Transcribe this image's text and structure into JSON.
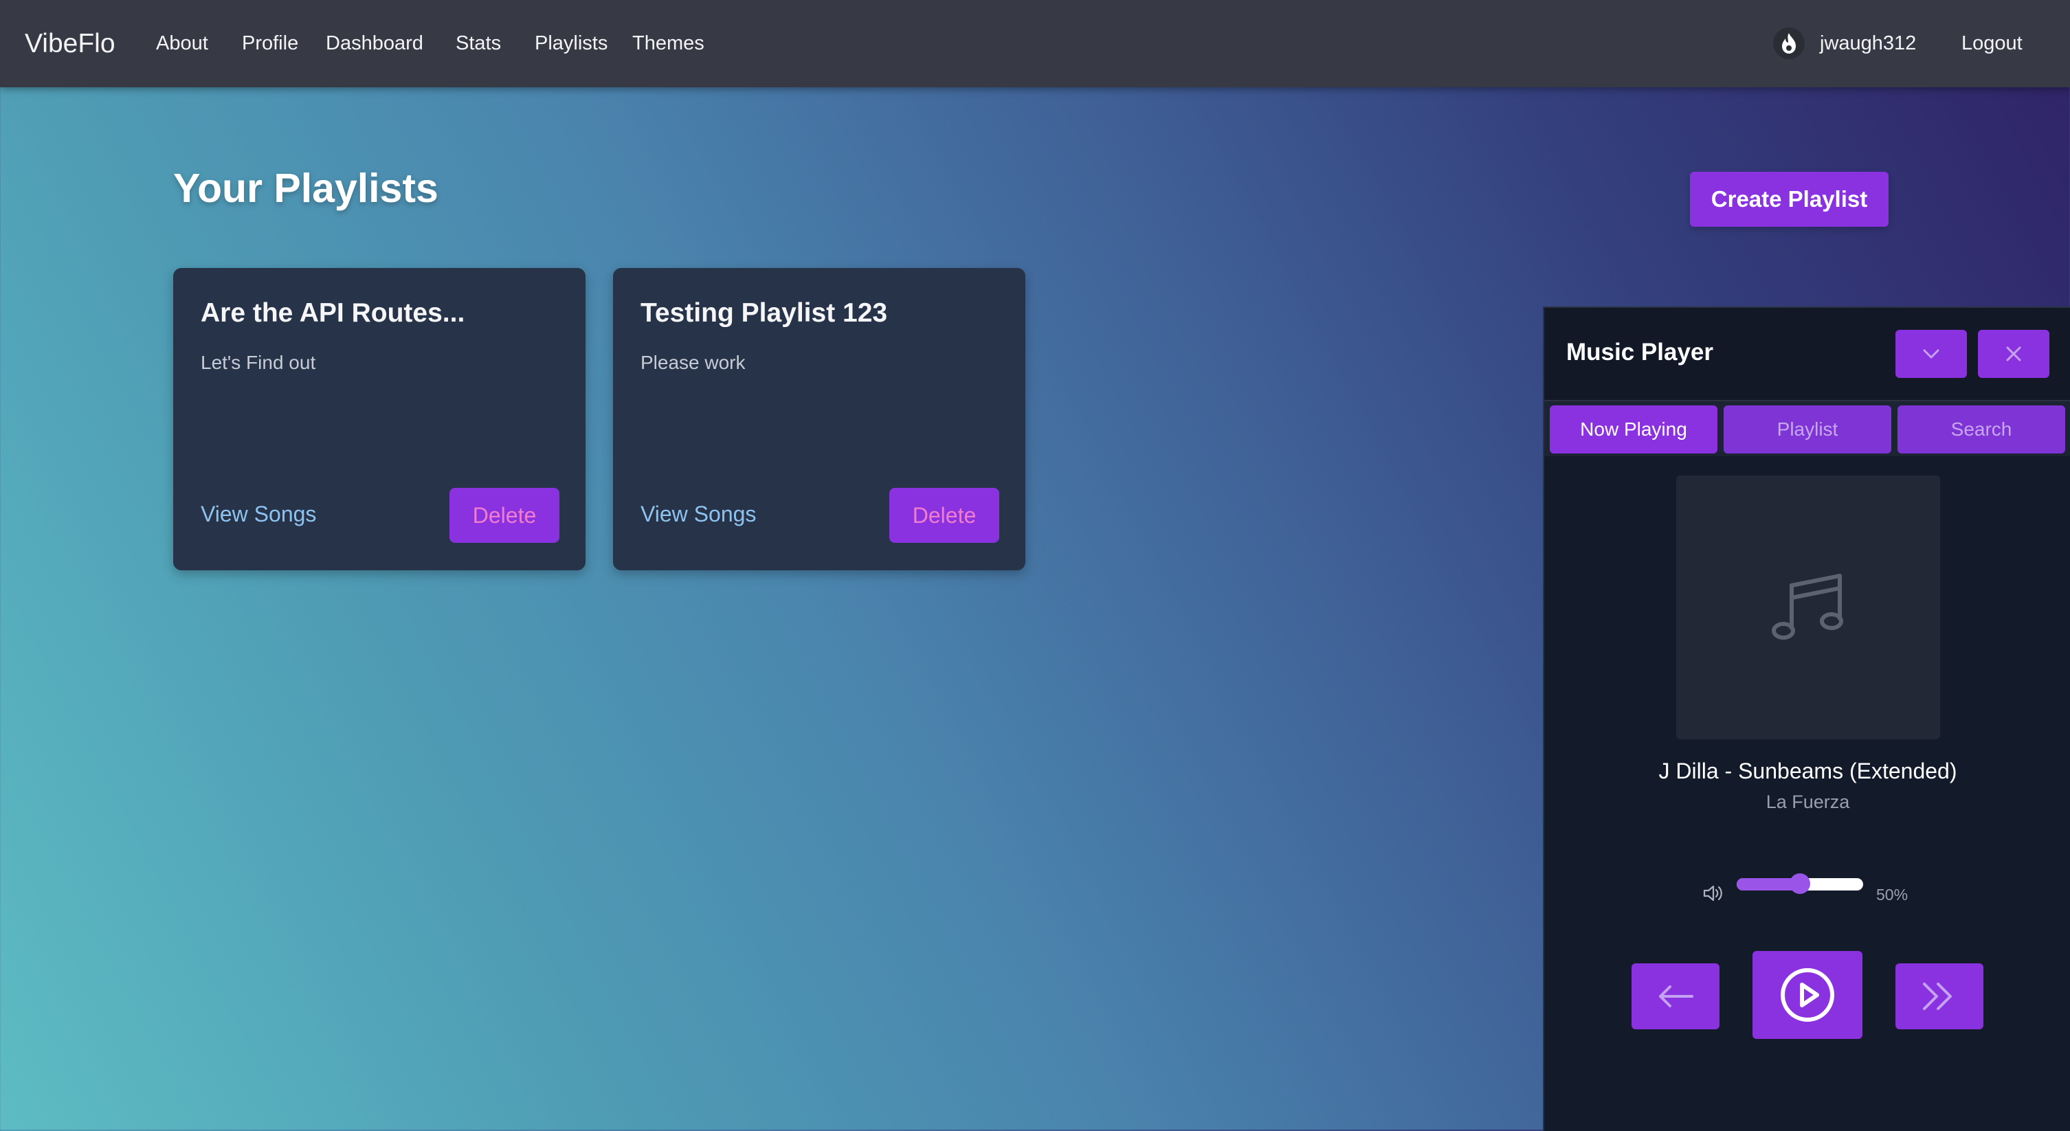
{
  "nav": {
    "brand": "VibeFlo",
    "links": [
      "About",
      "Profile",
      "Dashboard",
      "Stats",
      "Playlists",
      "Themes"
    ],
    "username": "jwaugh312",
    "logout": "Logout"
  },
  "page": {
    "title": "Your Playlists",
    "create_button": "Create Playlist"
  },
  "playlists": [
    {
      "title": "Are the API Routes...",
      "description": "Let's Find out",
      "view_label": "View Songs",
      "delete_label": "Delete"
    },
    {
      "title": "Testing Playlist 123",
      "description": "Please work",
      "view_label": "View Songs",
      "delete_label": "Delete"
    }
  ],
  "player": {
    "title": "Music Player",
    "tabs": [
      "Now Playing",
      "Playlist",
      "Search"
    ],
    "active_tab": "Now Playing",
    "song_title": "J Dilla - Sunbeams (Extended)",
    "artist": "La Fuerza",
    "volume": 0.5,
    "volume_label": "50%",
    "icons": {
      "minimize": "chevron-down-icon",
      "close": "close-icon",
      "album_art": "music-note-icon",
      "volume": "speaker-icon",
      "previous": "arrow-left-icon",
      "play": "play-circle-icon",
      "next": "double-chevron-right-icon"
    }
  },
  "colors": {
    "accent": "#8b32e0",
    "navbar": "#373a45",
    "card": "#263348",
    "player_bg": "#131a2a",
    "link": "#8ec3f0",
    "delete_text": "#f07ed0"
  }
}
